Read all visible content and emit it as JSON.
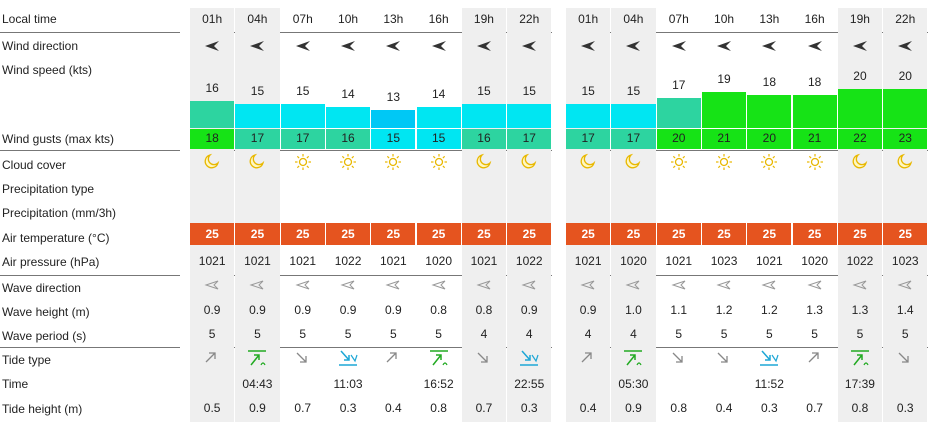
{
  "labels": {
    "local_time": "Local time",
    "wind_direction": "Wind direction",
    "wind_speed": "Wind speed  (kts)",
    "wind_gusts": "Wind gusts  (max kts)",
    "cloud_cover": "Cloud cover",
    "precip_type": "Precipitation type",
    "precipitation": "Precipitation  (mm/3h)",
    "air_temp": "Air temperature  (°C)",
    "air_pressure": "Air pressure  (hPa)",
    "wave_direction": "Wave direction",
    "wave_height": "Wave height  (m)",
    "wave_period": "Wave period  (s)",
    "tide_type": "Tide type",
    "time": "Time",
    "tide_height": "Tide height  (m)"
  },
  "colors": {
    "temp_bg": "#e5541f",
    "wind_low": "#00e6f2",
    "wind_mid": "#2dd4a0",
    "wind_high": "#16e316",
    "shade": "#efefef"
  },
  "days": [
    {
      "hours": [
        "01h",
        "04h",
        "07h",
        "10h",
        "13h",
        "16h",
        "19h",
        "22h"
      ],
      "shaded": [
        true,
        true,
        false,
        false,
        false,
        false,
        true,
        true
      ],
      "wind_speed": [
        "16",
        "15",
        "15",
        "14",
        "13",
        "14",
        "15",
        "15"
      ],
      "wind_speed_num": [
        16,
        15,
        15,
        14,
        13,
        14,
        15,
        15
      ],
      "wind_color": [
        "#2dd4a0",
        "#00e6f2",
        "#00e6f2",
        "#00e6f2",
        "#00c8f5",
        "#00e6f2",
        "#00e6f2",
        "#00e6f2"
      ],
      "wind_gusts": [
        "18",
        "17",
        "17",
        "16",
        "15",
        "15",
        "16",
        "17"
      ],
      "gust_color": [
        "#16e316",
        "#2dd4a0",
        "#2dd4a0",
        "#2dd4a0",
        "#00e6f2",
        "#00e6f2",
        "#2dd4a0",
        "#2dd4a0"
      ],
      "cloud": [
        "moon",
        "moon",
        "sun",
        "sun",
        "sun",
        "sun",
        "moon",
        "moon"
      ],
      "air_temp": [
        "25",
        "25",
        "25",
        "25",
        "25",
        "25",
        "25",
        "25"
      ],
      "pressure": [
        "1021",
        "1021",
        "1021",
        "1022",
        "1021",
        "1020",
        "1021",
        "1022"
      ],
      "wave_height": [
        "0.9",
        "0.9",
        "0.9",
        "0.9",
        "0.9",
        "0.8",
        "0.8",
        "0.9"
      ],
      "wave_period": [
        "5",
        "5",
        "5",
        "5",
        "5",
        "5",
        "4",
        "4"
      ],
      "tide_type": [
        "rising",
        "high",
        "falling",
        "low",
        "rising",
        "high",
        "falling",
        "low"
      ],
      "tide_time": [
        "",
        "04:43",
        "",
        "11:03",
        "",
        "16:52",
        "",
        "22:55"
      ],
      "tide_height": [
        "0.5",
        "0.9",
        "0.7",
        "0.3",
        "0.4",
        "0.8",
        "0.7",
        "0.3"
      ]
    },
    {
      "hours": [
        "01h",
        "04h",
        "07h",
        "10h",
        "13h",
        "16h",
        "19h",
        "22h"
      ],
      "shaded": [
        true,
        true,
        false,
        false,
        false,
        false,
        true,
        true
      ],
      "wind_speed": [
        "15",
        "15",
        "17",
        "19",
        "18",
        "18",
        "20",
        "20"
      ],
      "wind_speed_num": [
        15,
        15,
        17,
        19,
        18,
        18,
        20,
        20
      ],
      "wind_color": [
        "#00e6f2",
        "#00e6f2",
        "#2dd4a0",
        "#16e316",
        "#16e316",
        "#16e316",
        "#16e316",
        "#16e316"
      ],
      "wind_gusts": [
        "17",
        "17",
        "20",
        "21",
        "20",
        "21",
        "22",
        "23"
      ],
      "gust_color": [
        "#2dd4a0",
        "#2dd4a0",
        "#16e316",
        "#16e316",
        "#16e316",
        "#16e316",
        "#16e316",
        "#16e316"
      ],
      "cloud": [
        "moon",
        "moon",
        "sun",
        "sun",
        "sun",
        "sun",
        "moon",
        "moon"
      ],
      "air_temp": [
        "25",
        "25",
        "25",
        "25",
        "25",
        "25",
        "25",
        "25"
      ],
      "pressure": [
        "1021",
        "1020",
        "1021",
        "1023",
        "1021",
        "1020",
        "1022",
        "1023"
      ],
      "wave_height": [
        "0.9",
        "1.0",
        "1.1",
        "1.2",
        "1.2",
        "1.3",
        "1.3",
        "1.4"
      ],
      "wave_period": [
        "4",
        "4",
        "5",
        "5",
        "5",
        "5",
        "5",
        "5"
      ],
      "tide_type": [
        "rising",
        "high",
        "falling",
        "falling",
        "low",
        "rising",
        "high",
        "falling"
      ],
      "tide_time": [
        "",
        "05:30",
        "",
        "",
        "11:52",
        "",
        "17:39",
        ""
      ],
      "tide_height": [
        "0.4",
        "0.9",
        "0.8",
        "0.4",
        "0.3",
        "0.7",
        "0.8",
        "0.3"
      ]
    }
  ]
}
